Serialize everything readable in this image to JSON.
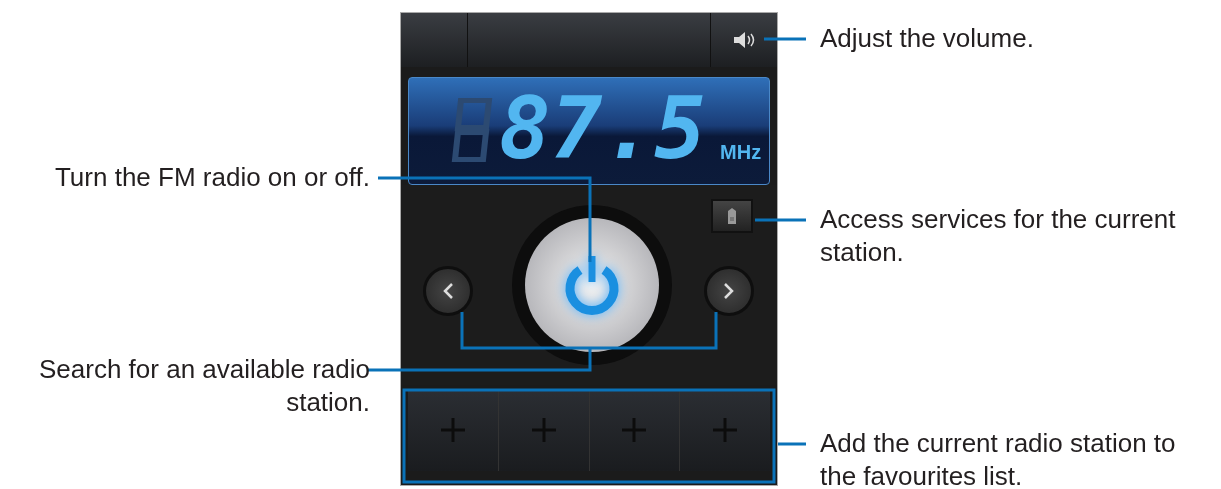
{
  "display": {
    "frequency": "87.5",
    "unit": "MHz"
  },
  "power": {
    "on": true
  },
  "callouts": [
    {
      "text": "Adjust the volume."
    },
    {
      "text": "Turn the FM radio on or off."
    },
    {
      "text": "Access services for the current\nstation."
    },
    {
      "text": "Search for an available radio\nstation."
    },
    {
      "text": "Add the current radio station to\nthe favourites list."
    }
  ]
}
